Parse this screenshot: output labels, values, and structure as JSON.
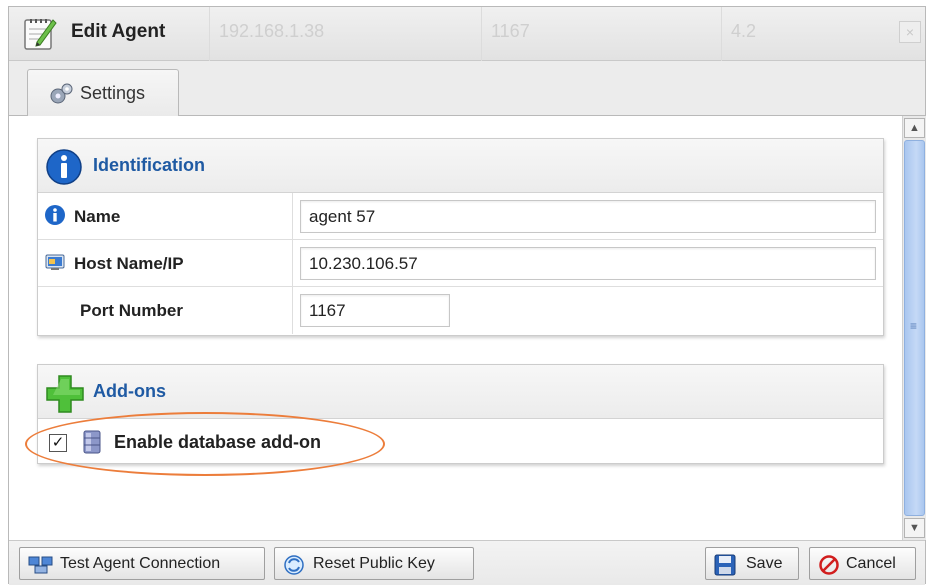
{
  "dialog": {
    "title": "Edit Agent",
    "background_row": [
      "192.168.1.38",
      "1167",
      "4.2"
    ],
    "close_glyph": "×"
  },
  "tabs": [
    {
      "label": "Settings",
      "icon": "gear-icon"
    }
  ],
  "identification": {
    "title": "Identification",
    "rows": [
      {
        "label": "Name",
        "icon": "info-icon",
        "value": "agent 57"
      },
      {
        "label": "Host Name/IP",
        "icon": "host-icon",
        "value": "10.230.106.57"
      },
      {
        "label": "Port Number",
        "icon": "",
        "value": "1167"
      }
    ]
  },
  "addons": {
    "title": "Add-ons",
    "database": {
      "label": "Enable database add-on",
      "checked": true,
      "check_glyph": "✓"
    }
  },
  "scrollbar": {
    "grip_glyph": "≡",
    "up_glyph": "▲",
    "down_glyph": "▼"
  },
  "footer": {
    "test_label": "Test Agent Connection",
    "reset_label": "Reset Public Key",
    "save_label": "Save",
    "cancel_label": "Cancel"
  },
  "colors": {
    "accent": "#1f5aa3",
    "highlight": "#ec7d3b",
    "add_icon": "#4fc03a"
  }
}
